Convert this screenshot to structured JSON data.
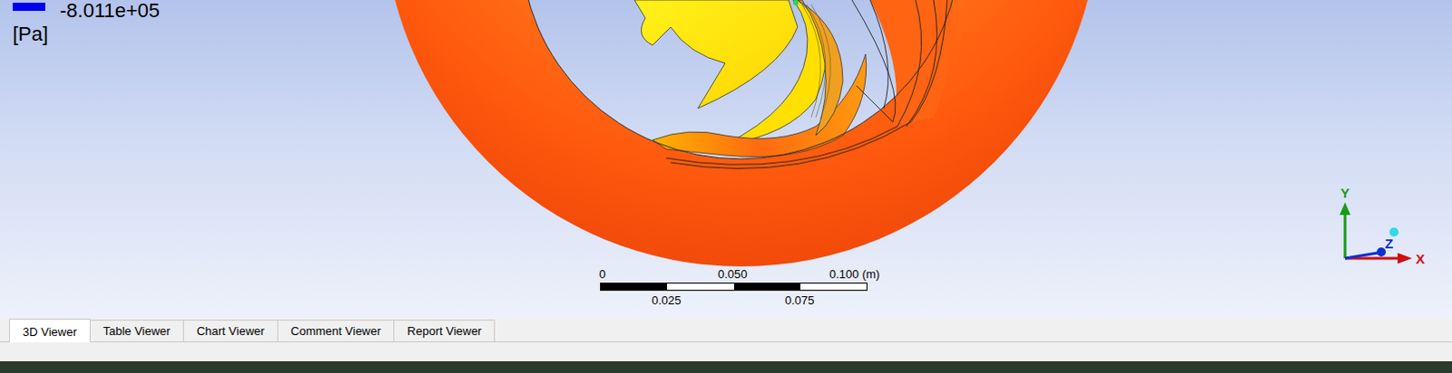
{
  "legend": {
    "min_value": "-8.011e+05",
    "unit": "[Pa]"
  },
  "scale_bar": {
    "top_labels": [
      "0",
      "0.050",
      "0.100 (m)"
    ],
    "bottom_labels": [
      "0.025",
      "0.075"
    ]
  },
  "axes": {
    "y": "Y",
    "z": "Z",
    "x": "X"
  },
  "tabs": [
    {
      "label": "3D Viewer",
      "selected": true
    },
    {
      "label": "Table Viewer",
      "selected": false
    },
    {
      "label": "Chart Viewer",
      "selected": false
    },
    {
      "label": "Comment Viewer",
      "selected": false
    },
    {
      "label": "Report Viewer",
      "selected": false
    }
  ]
}
